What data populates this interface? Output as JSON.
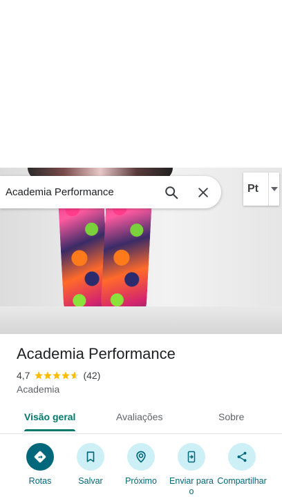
{
  "search": {
    "query": "Academia Performance"
  },
  "language": {
    "code": "Pt"
  },
  "place": {
    "name": "Academia Performance",
    "rating": "4,7",
    "rating_value": 4.7,
    "reviews": "(42)",
    "category": "Academia"
  },
  "tabs": [
    {
      "label": "Visão geral",
      "active": true
    },
    {
      "label": "Avaliações",
      "active": false
    },
    {
      "label": "Sobre",
      "active": false
    }
  ],
  "actions": [
    {
      "label": "Rotas",
      "icon": "directions-icon"
    },
    {
      "label": "Salvar",
      "icon": "bookmark-icon"
    },
    {
      "label": "Próximo",
      "icon": "nearby-icon"
    },
    {
      "label": "Enviar para o",
      "icon": "send-to-phone-icon"
    },
    {
      "label": "Compartilhar",
      "icon": "share-icon"
    }
  ],
  "colors": {
    "accent": "#00796b",
    "action_primary": "#00687a",
    "action_bg": "#cdeff6",
    "star": "#fbbc04"
  }
}
